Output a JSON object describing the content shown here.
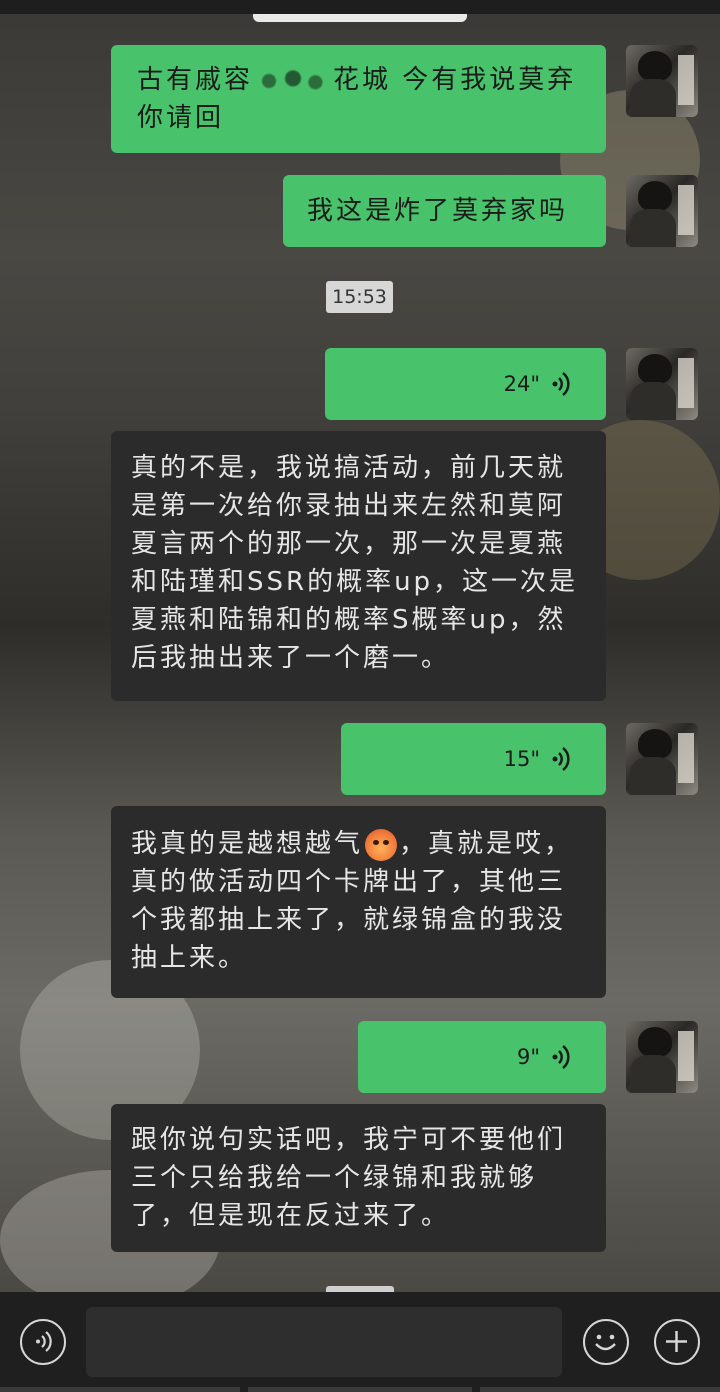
{
  "messages": [
    {
      "side": "me",
      "type": "text",
      "text_before_blur": "古有戚容",
      "text_after_blur": "花城  今有我说莫弃你请回"
    },
    {
      "side": "me",
      "type": "text",
      "text": "我这是炸了莫弃家吗"
    },
    {
      "type": "timestamp",
      "text": "15:53"
    },
    {
      "side": "me",
      "type": "voice",
      "duration": "24\""
    },
    {
      "side": "them",
      "type": "text",
      "text": "真的不是，我说搞活动，前几天就是第一次给你录抽出来左然和莫阿夏言两个的那一次，那一次是夏燕和陆瑾和SSR的概率up，这一次是夏燕和陆锦和的概率S概率up，然后我抽出来了一个磨一。"
    },
    {
      "side": "me",
      "type": "voice",
      "duration": "15\""
    },
    {
      "side": "them",
      "type": "text",
      "text_before_emoji": "我真的是越想越气",
      "emoji": "angry-face-icon",
      "text_after_emoji": "，真就是哎，真的做活动四个卡牌出了，其他三个我都抽上来了，就绿锦盒的我没抽上来。"
    },
    {
      "side": "me",
      "type": "voice",
      "duration": "9\""
    },
    {
      "side": "them",
      "type": "text",
      "text": "跟你说句实话吧，我宁可不要他们三个只给我给一个绿锦和我就够了，但是现在反过来了。"
    }
  ],
  "bottom_bar": {
    "voice_button_icon": "voice-input-icon",
    "emoji_button_icon": "emoji-smile-icon",
    "plus_button_icon": "plus-icon",
    "input_value": ""
  },
  "colors": {
    "my_bubble": "#48c26b",
    "their_bubble": "#2b2b2b",
    "timestamp_bg": "#d7d7d7",
    "bottom_bar": "#1f1f1f"
  }
}
